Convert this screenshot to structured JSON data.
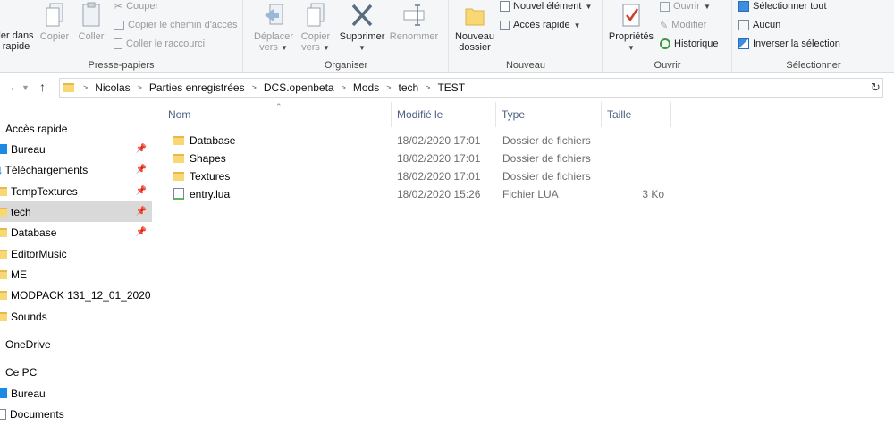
{
  "ribbon": {
    "clipboard": {
      "label": "Presse-papiers",
      "pin_label_line1": "ler dans",
      "pin_label_line2": "rapide",
      "copy_label": "Copier",
      "paste_label": "Coller",
      "cut_label": "Couper",
      "copy_path_label": "Copier le chemin d'accès",
      "paste_shortcut_label": "Coller le raccourci"
    },
    "organize": {
      "label": "Organiser",
      "move_label_line1": "Déplacer",
      "move_label_line2": "vers",
      "copyto_label_line1": "Copier",
      "copyto_label_line2": "vers",
      "delete_label": "Supprimer",
      "rename_label": "Renommer"
    },
    "new": {
      "label": "Nouveau",
      "new_folder_line1": "Nouveau",
      "new_folder_line2": "dossier",
      "new_item_label": "Nouvel élément",
      "easy_access_label": "Accès rapide"
    },
    "open": {
      "label": "Ouvrir",
      "properties_label": "Propriétés",
      "open_label": "Ouvrir",
      "edit_label": "Modifier",
      "history_label": "Historique"
    },
    "select": {
      "label": "Sélectionner",
      "select_all_label": "Sélectionner tout",
      "select_none_label": "Aucun",
      "invert_label": "Inverser la sélection"
    }
  },
  "address": {
    "breadcrumbs": [
      "Nicolas",
      "Parties enregistrées",
      "DCS.openbeta",
      "Mods",
      "tech",
      "TEST"
    ]
  },
  "navpane": {
    "quick_access": "Accès rapide",
    "items": [
      "Bureau",
      "Téléchargements",
      "TempTextures",
      "tech",
      "Database",
      "EditorMusic",
      "ME",
      "MODPACK 131_12_01_2020",
      "Sounds"
    ],
    "onedrive": "OneDrive",
    "thispc": "Ce PC",
    "pc_items": [
      "Bureau",
      "Documents"
    ]
  },
  "columns": {
    "name": "Nom",
    "modified": "Modifié le",
    "type": "Type",
    "size": "Taille"
  },
  "files": [
    {
      "name": "Database",
      "modified": "18/02/2020 17:01",
      "type": "Dossier de fichiers",
      "size": ""
    },
    {
      "name": "Shapes",
      "modified": "18/02/2020 17:01",
      "type": "Dossier de fichiers",
      "size": ""
    },
    {
      "name": "Textures",
      "modified": "18/02/2020 17:01",
      "type": "Dossier de fichiers",
      "size": ""
    },
    {
      "name": "entry.lua",
      "modified": "18/02/2020 15:26",
      "type": "Fichier LUA",
      "size": "3 Ko"
    }
  ],
  "colors": {
    "folder": "#f8d775",
    "selected": "#cce8ff",
    "header_text": "#4d6082",
    "accent_blue": "#1e88e5"
  }
}
